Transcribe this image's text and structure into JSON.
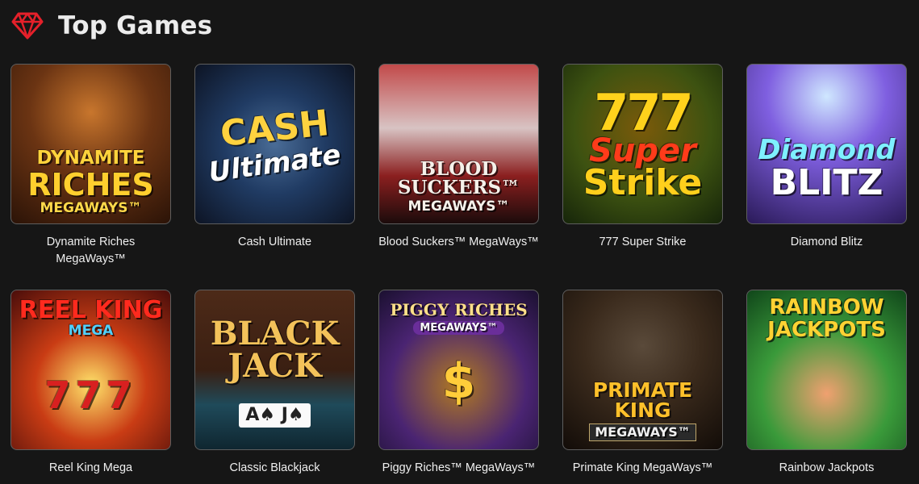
{
  "header": {
    "title": "Top Games",
    "icon": "gem-icon",
    "accent_color": "#e5202a"
  },
  "games": [
    {
      "name": "Dynamite Riches MegaWays™",
      "art": [
        "DYNAMITE",
        "RICHES",
        "MEGAWAYS™"
      ]
    },
    {
      "name": "Cash Ultimate",
      "art": [
        "CASH",
        "Ultimate"
      ]
    },
    {
      "name": "Blood Suckers™ MegaWays™",
      "art": [
        "BLOOD SUCKERS™",
        "MEGAWAYS™"
      ]
    },
    {
      "name": "777 Super Strike",
      "art": [
        "777",
        "Super",
        "Strike"
      ]
    },
    {
      "name": "Diamond Blitz",
      "art": [
        "Diamond",
        "BLITZ"
      ]
    },
    {
      "name": "Reel King Mega",
      "art": [
        "REEL KING",
        "MEGA",
        "777"
      ]
    },
    {
      "name": "Classic Blackjack",
      "art": [
        "BLACK",
        "JACK",
        "A♠ J♠"
      ]
    },
    {
      "name": "Piggy Riches™ MegaWays™",
      "art": [
        "PIGGY RICHES",
        "MEGAWAYS™",
        "$"
      ]
    },
    {
      "name": "Primate King MegaWays™",
      "art": [
        "PRIMATE KING",
        "MEGAWAYS™"
      ]
    },
    {
      "name": "Rainbow Jackpots",
      "art": [
        "RAINBOW",
        "JACKPOTS"
      ]
    }
  ]
}
